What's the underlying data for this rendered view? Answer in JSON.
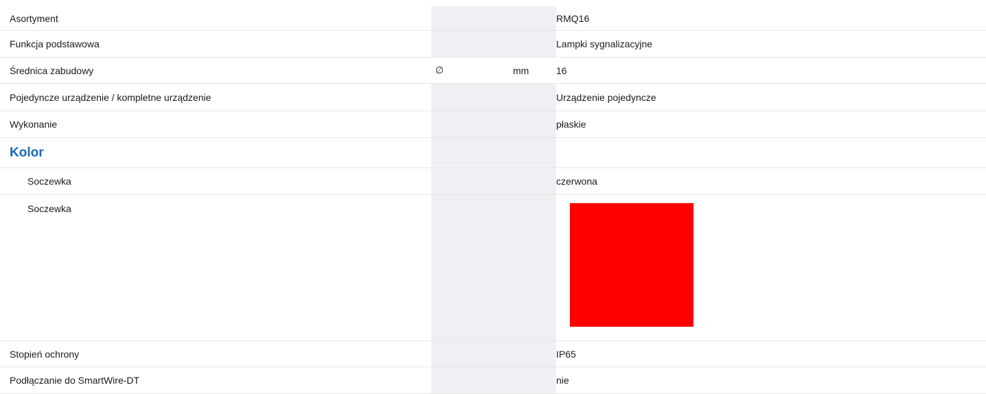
{
  "rows": [
    {
      "label": "Asortyment",
      "value": "RMQ16"
    },
    {
      "label": "Funkcja podstawowa",
      "value": "Lampki sygnalizacyjne"
    },
    {
      "label": "Średnica zabudowy",
      "symbol": "∅",
      "unit": "mm",
      "value": "16"
    },
    {
      "label": "Pojedyncze urządzenie / kompletne urządzenie",
      "value": "Urządzenie pojedyncze"
    },
    {
      "label": "Wykonanie",
      "value": "płaskie"
    }
  ],
  "section_kolor": {
    "title": "Kolor"
  },
  "kolor_rows": [
    {
      "label": "Soczewka",
      "value": "czerwona"
    },
    {
      "label": "Soczewka",
      "swatch_color": "#ff0000"
    }
  ],
  "bottom_rows": [
    {
      "label": "Stopień ochrony",
      "value": "IP65"
    },
    {
      "label": "Podłączanie do SmartWire-DT",
      "value": "nie"
    }
  ]
}
